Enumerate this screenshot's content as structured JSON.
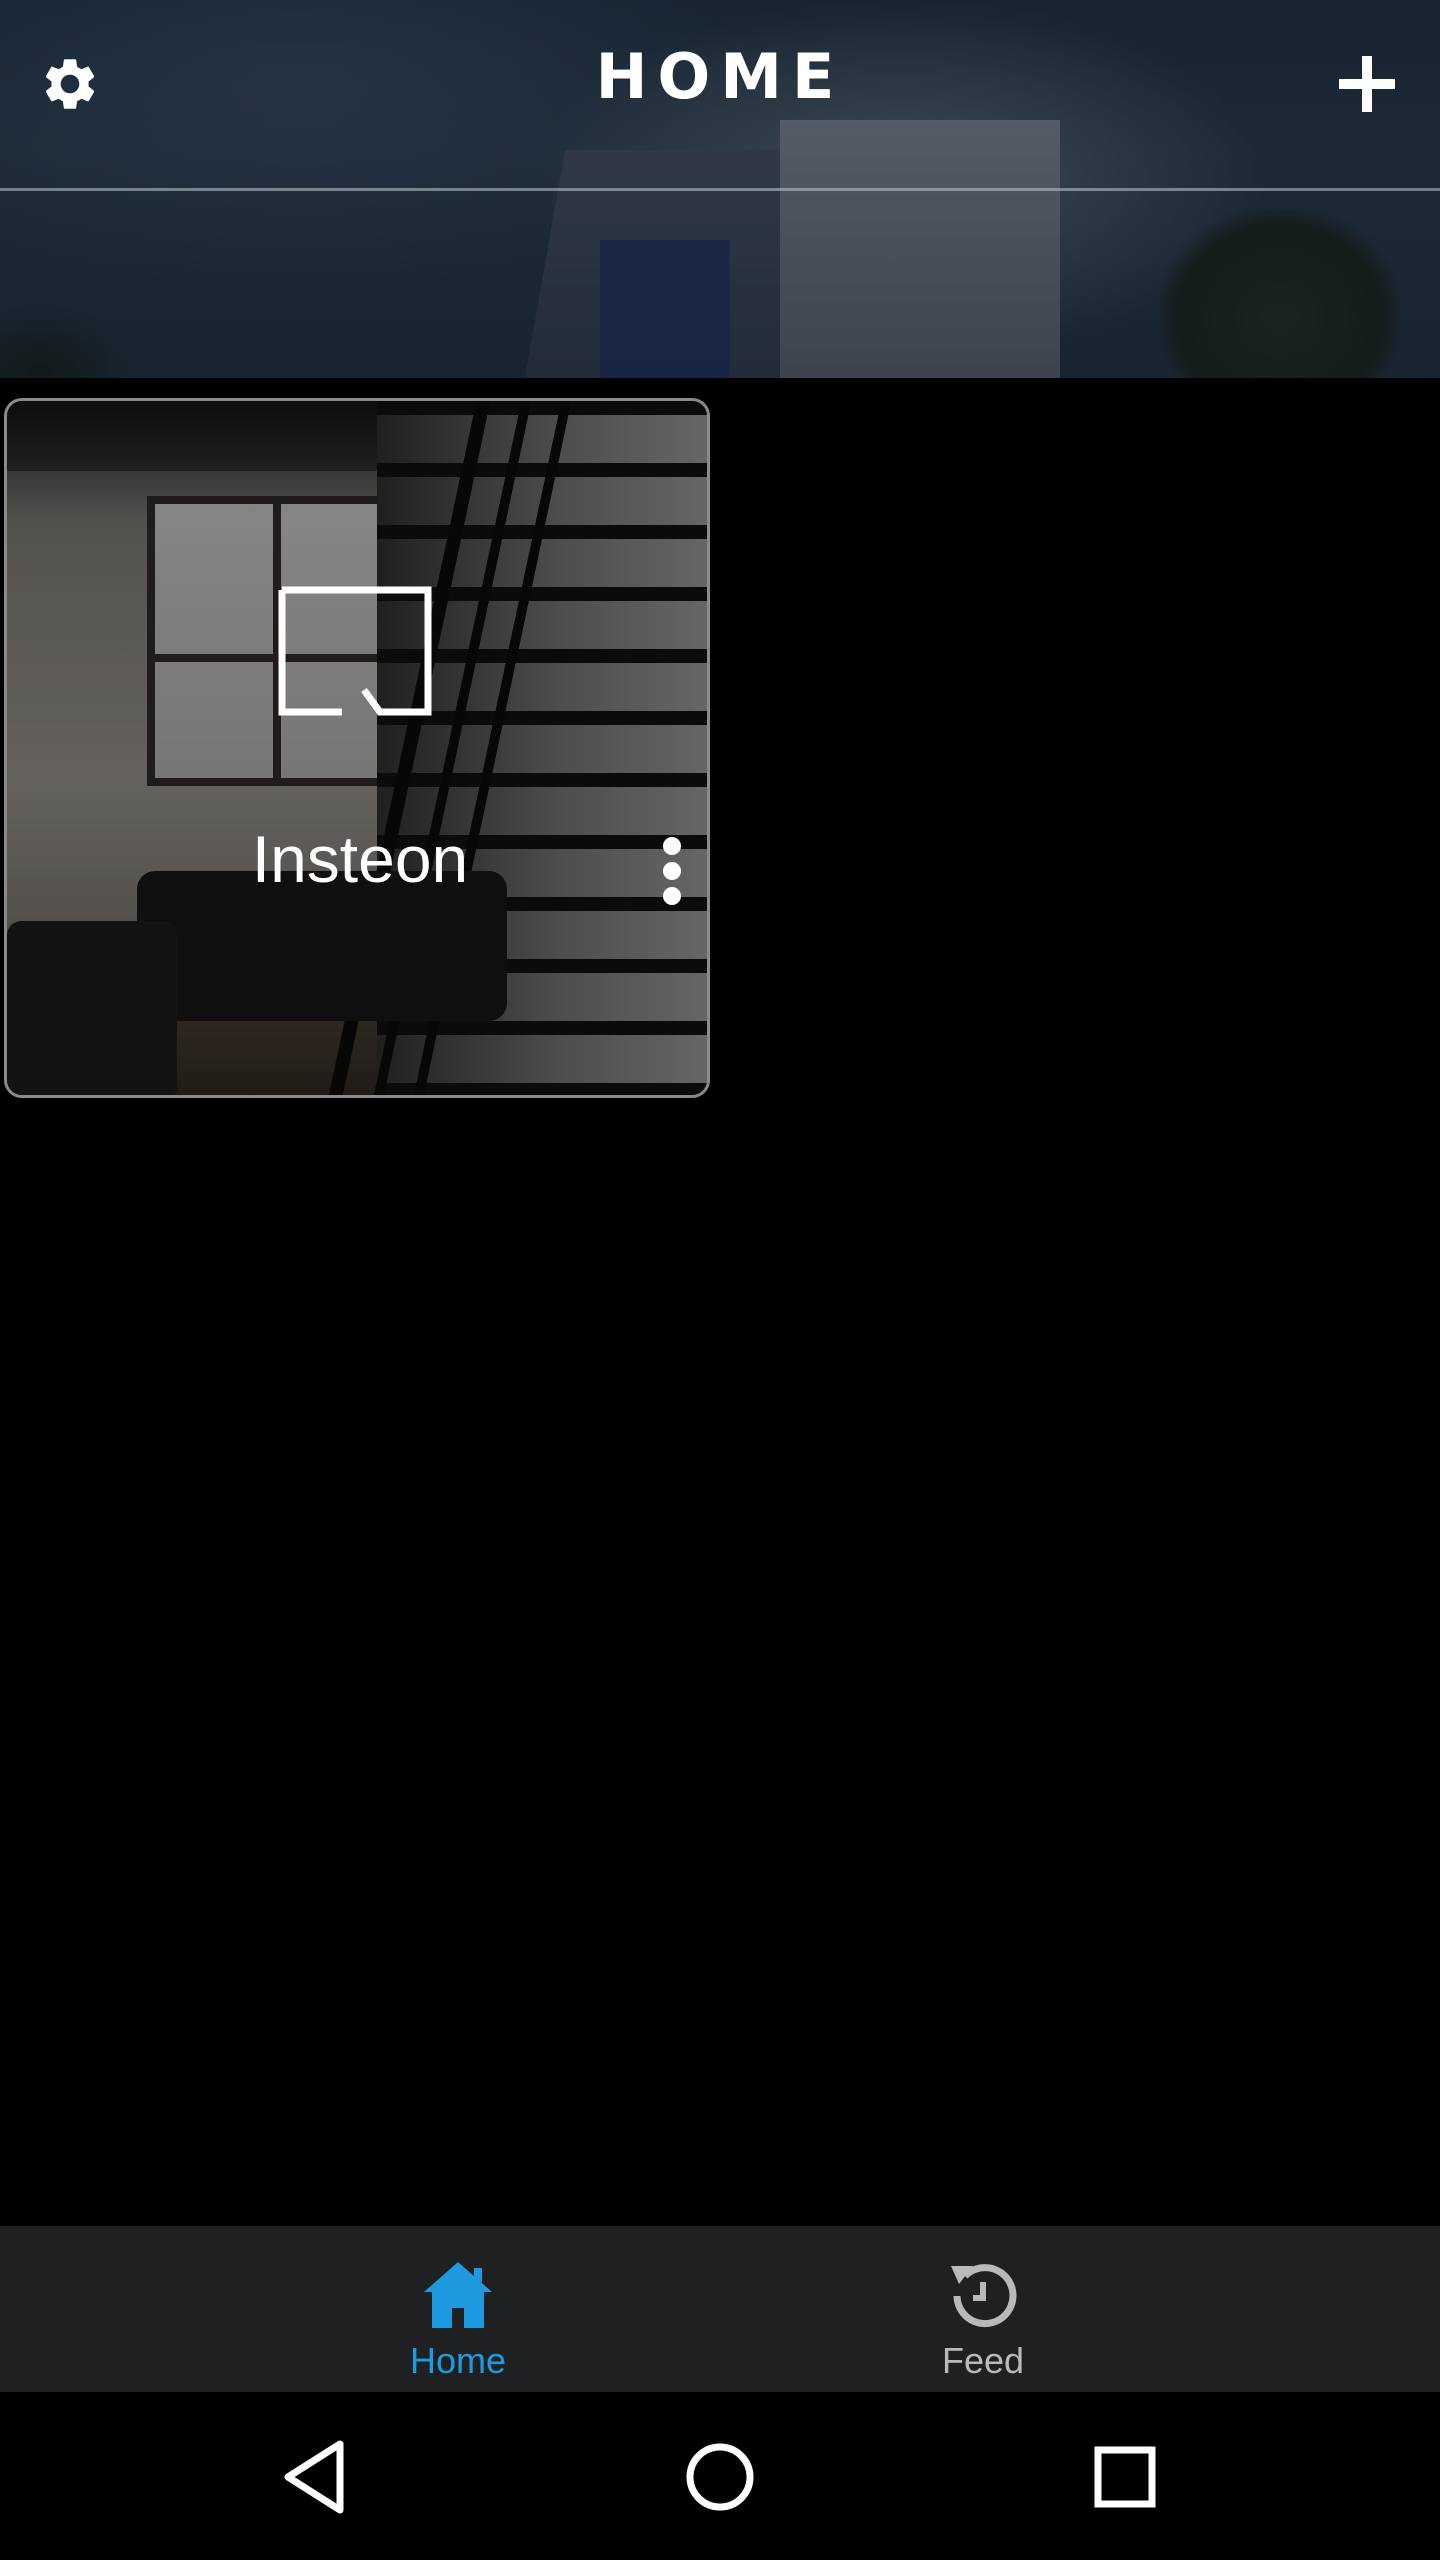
{
  "header": {
    "title": "HOME",
    "settings_icon": "gear-icon",
    "add_icon": "plus-icon"
  },
  "cards": [
    {
      "title": "Insteon",
      "icon": "device-corner-icon",
      "menu_icon": "more-vertical-icon"
    }
  ],
  "bottom_nav": {
    "items": [
      {
        "label": "Home",
        "icon": "home-icon",
        "active": true
      },
      {
        "label": "Feed",
        "icon": "history-icon",
        "active": false
      }
    ]
  },
  "system_nav": {
    "back_icon": "back-triangle-icon",
    "home_icon": "home-circle-icon",
    "recents_icon": "recents-square-icon"
  },
  "colors": {
    "accent": "#1e9be0",
    "inactive": "#b9b9b9",
    "background": "#000000",
    "bottom_nav_bg": "#1f2022"
  }
}
